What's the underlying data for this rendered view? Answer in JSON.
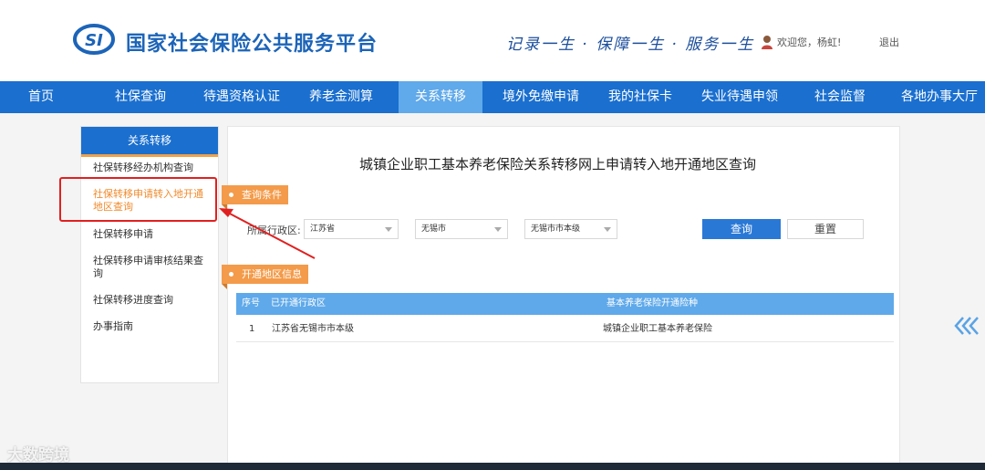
{
  "header": {
    "logo_text": "SI",
    "site_title": "国家社会保险公共服务平台",
    "slogan": "记录一生 · 保障一生 · 服务一生",
    "welcome": "欢迎您，杨虹!",
    "logout": "退出"
  },
  "nav": {
    "items": [
      {
        "label": "首页"
      },
      {
        "label": "社保查询"
      },
      {
        "label": "待遇资格认证"
      },
      {
        "label": "养老金测算"
      },
      {
        "label": "关系转移"
      },
      {
        "label": "境外免缴申请"
      },
      {
        "label": "我的社保卡"
      },
      {
        "label": "失业待遇申领"
      },
      {
        "label": "社会监督"
      },
      {
        "label": "各地办事大厅"
      }
    ],
    "active": "关系转移"
  },
  "sidebar": {
    "title": "关系转移",
    "items": [
      {
        "label": "社保转移经办机构查询"
      },
      {
        "label": "社保转移申请转入地开通地区查询"
      },
      {
        "label": "社保转移申请"
      },
      {
        "label": "社保转移申请审核结果查询"
      },
      {
        "label": "社保转移进度查询"
      },
      {
        "label": "办事指南"
      }
    ]
  },
  "main": {
    "title": "城镇企业职工基本养老保险关系转移网上申请转入地开通地区查询",
    "query_tag": "查询条件",
    "filter_label": "所属行政区:",
    "province": "江苏省",
    "city": "无锡市",
    "district": "无锡市市本级",
    "query_button": "查询",
    "reset_button": "重置",
    "result_tag": "开通地区信息",
    "table": {
      "headers": [
        "序号",
        "已开通行政区",
        "基本养老保险开通险种"
      ],
      "rows": [
        [
          "1",
          "江苏省无锡市市本级",
          "城镇企业职工基本养老保险"
        ]
      ]
    }
  },
  "watermark": "大数跨境",
  "colors": {
    "nav_bg": "#1a6fcf",
    "nav_active": "#60a9ea",
    "accent_orange": "#f39b4a",
    "highlight_red": "#e02020",
    "table_head": "#5fa9ea"
  }
}
